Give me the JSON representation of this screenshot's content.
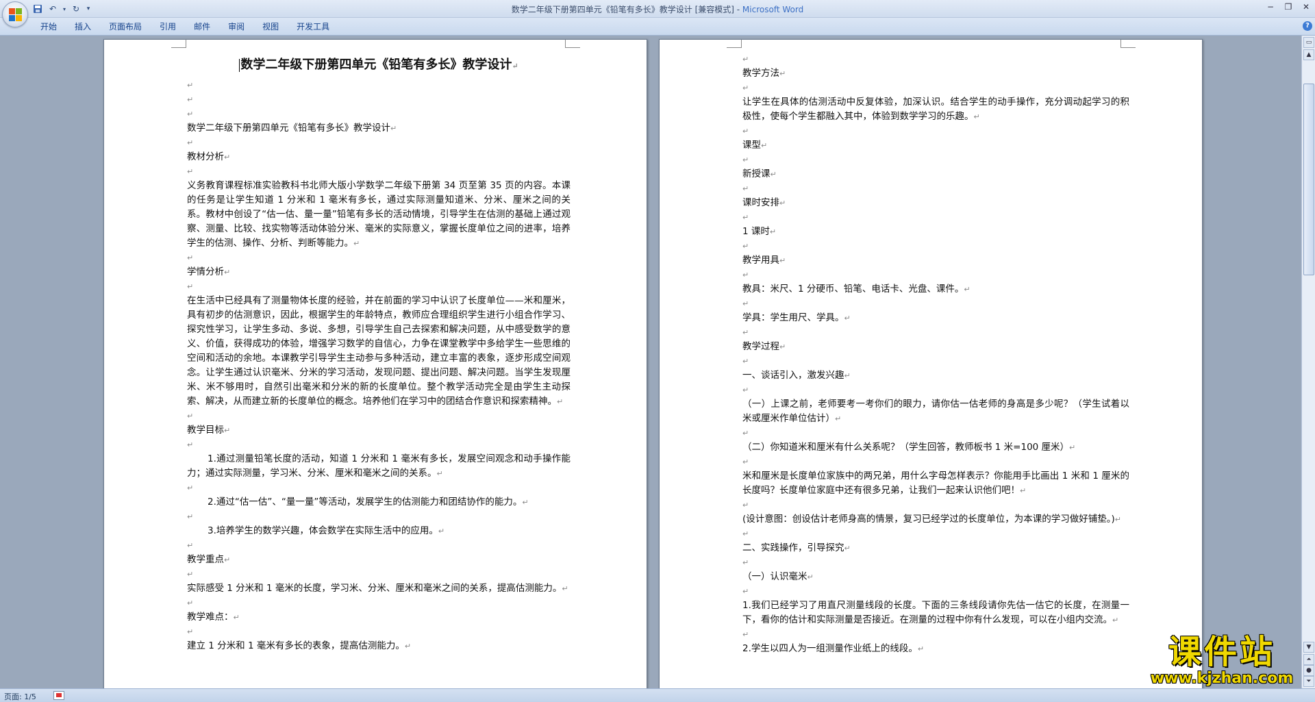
{
  "window": {
    "title": "数学二年级下册第四单元《铅笔有多长》教学设计 [兼容模式] - ",
    "app_name": "Microsoft Word",
    "minimize": "−",
    "restore": "❐",
    "close": "✕"
  },
  "ribbon": {
    "tabs": [
      "开始",
      "插入",
      "页面布局",
      "引用",
      "邮件",
      "审阅",
      "视图",
      "开发工具"
    ],
    "help": "?"
  },
  "page1": {
    "title": "数学二年级下册第四单元《铅笔有多长》教学设计",
    "lines": [
      {
        "type": "empty"
      },
      {
        "type": "empty"
      },
      {
        "type": "empty"
      },
      {
        "type": "text",
        "text": "数学二年级下册第四单元《铅笔有多长》教学设计"
      },
      {
        "type": "empty"
      },
      {
        "type": "text",
        "text": "教材分析"
      },
      {
        "type": "empty"
      },
      {
        "type": "text",
        "text": "义务教育课程标准实验教科书北师大版小学数学二年级下册第 34 页至第 35 页的内容。本课的任务是让学生知道 1 分米和 1 毫米有多长，通过实际测量知道米、分米、厘米之间的关系。教材中创设了“估一估、量一量”铅笔有多长的活动情境，引导学生在估测的基础上通过观察、测量、比较、找实物等活动体验分米、毫米的实际意义，掌握长度单位之间的进率，培养学生的估测、操作、分析、判断等能力。"
      },
      {
        "type": "empty"
      },
      {
        "type": "text",
        "text": "学情分析"
      },
      {
        "type": "empty"
      },
      {
        "type": "text",
        "text": "在生活中已经具有了测量物体长度的经验，并在前面的学习中认识了长度单位——米和厘米，具有初步的估测意识，因此，根据学生的年龄特点，教师应合理组织学生进行小组合作学习、探究性学习，让学生多动、多说、多想，引导学生自己去探索和解决问题，从中感受数学的意义、价值，获得成功的体验，增强学习数学的自信心，力争在课堂教学中多给学生一些思维的空间和活动的余地。本课教学引导学生主动参与多种活动，建立丰富的表象，逐步形成空间观念。让学生通过认识毫米、分米的学习活动，发现问题、提出问题、解决问题。当学生发现厘米、米不够用时，自然引出毫米和分米的新的长度单位。整个教学活动完全是由学生主动探索、解决，从而建立新的长度单位的概念。培养他们在学习中的团结合作意识和探索精神。"
      },
      {
        "type": "empty"
      },
      {
        "type": "text",
        "text": "教学目标"
      },
      {
        "type": "empty"
      },
      {
        "type": "indent",
        "text": "1.通过测量铅笔长度的活动，知道 1 分米和 1 毫米有多长，发展空间观念和动手操作能力；通过实际测量，学习米、分米、厘米和毫米之间的关系。"
      },
      {
        "type": "empty"
      },
      {
        "type": "indent",
        "text": "2.通过“估一估”、“量一量”等活动，发展学生的估测能力和团结协作的能力。"
      },
      {
        "type": "empty"
      },
      {
        "type": "indent",
        "text": "3.培养学生的数学兴趣，体会数学在实际生活中的应用。"
      },
      {
        "type": "empty"
      },
      {
        "type": "text",
        "text": "教学重点"
      },
      {
        "type": "empty"
      },
      {
        "type": "text",
        "text": "实际感受 1 分米和 1 毫米的长度，学习米、分米、厘米和毫米之间的关系，提高估测能力。"
      },
      {
        "type": "empty"
      },
      {
        "type": "text",
        "text": "教学难点："
      },
      {
        "type": "empty"
      },
      {
        "type": "text",
        "text": "建立 1 分米和 1 毫米有多长的表象，提高估测能力。"
      }
    ]
  },
  "page2": {
    "lines": [
      {
        "type": "empty"
      },
      {
        "type": "text",
        "text": "教学方法"
      },
      {
        "type": "empty"
      },
      {
        "type": "text",
        "text": "让学生在具体的估测活动中反复体验，加深认识。结合学生的动手操作，充分调动起学习的积极性，使每个学生都融入其中，体验到数学学习的乐趣。"
      },
      {
        "type": "empty"
      },
      {
        "type": "text",
        "text": "课型"
      },
      {
        "type": "empty"
      },
      {
        "type": "text",
        "text": "新授课"
      },
      {
        "type": "empty"
      },
      {
        "type": "text",
        "text": "课时安排"
      },
      {
        "type": "empty"
      },
      {
        "type": "text",
        "text": "1 课时"
      },
      {
        "type": "empty"
      },
      {
        "type": "text",
        "text": "教学用具"
      },
      {
        "type": "empty"
      },
      {
        "type": "text",
        "text": "教具：米尺、1 分硬币、铅笔、电话卡、光盘、课件。"
      },
      {
        "type": "empty"
      },
      {
        "type": "text",
        "text": "学具：学生用尺、学具。"
      },
      {
        "type": "empty"
      },
      {
        "type": "text",
        "text": "教学过程"
      },
      {
        "type": "empty"
      },
      {
        "type": "text",
        "text": "一、谈话引入，激发兴趣"
      },
      {
        "type": "empty"
      },
      {
        "type": "text",
        "text": "（一）上课之前，老师要考一考你们的眼力，请你估一估老师的身高是多少呢？（学生试着以米或厘米作单位估计）"
      },
      {
        "type": "empty"
      },
      {
        "type": "text",
        "text": "（二）你知道米和厘米有什么关系呢？（学生回答，教师板书  1 米=100 厘米）"
      },
      {
        "type": "empty"
      },
      {
        "type": "text",
        "text": "米和厘米是长度单位家族中的两兄弟，用什么字母怎样表示？你能用手比画出 1 米和 1 厘米的长度吗？长度单位家庭中还有很多兄弟，让我们一起来认识他们吧！"
      },
      {
        "type": "empty"
      },
      {
        "type": "text",
        "text": "(设计意图：创设估计老师身高的情景，复习已经学过的长度单位，为本课的学习做好铺垫。)"
      },
      {
        "type": "empty"
      },
      {
        "type": "text",
        "text": "二、实践操作，引导探究"
      },
      {
        "type": "empty"
      },
      {
        "type": "text",
        "text": "（一）认识毫米"
      },
      {
        "type": "empty"
      },
      {
        "type": "text",
        "text": "1.我们已经学习了用直尺测量线段的长度。下面的三条线段请你先估一估它的长度，在测量一下，看你的估计和实际测量是否接近。在测量的过程中你有什么发现，可以在小组内交流。"
      },
      {
        "type": "empty"
      },
      {
        "type": "text",
        "text": "2.学生以四人为一组测量作业纸上的线段。"
      }
    ]
  },
  "paragraph_mark": "↵",
  "statusbar": {
    "page_indicator": "页面: 1/5"
  },
  "watermark": {
    "text": "课件站",
    "url": "www.kjzhan.com"
  }
}
